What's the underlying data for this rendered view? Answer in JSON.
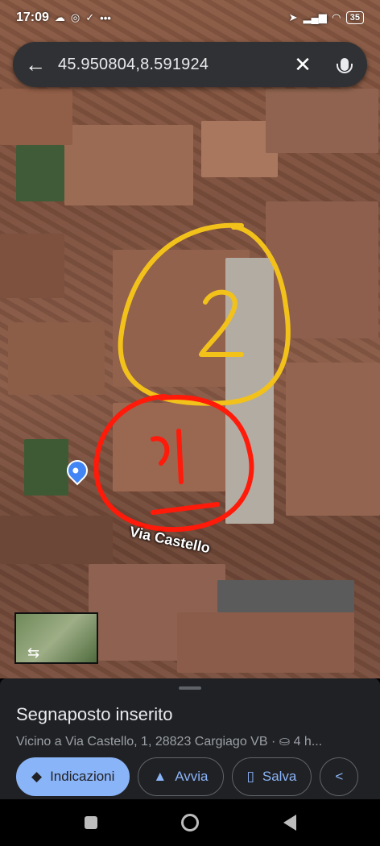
{
  "status": {
    "time": "17:09",
    "battery": "35"
  },
  "search": {
    "query": "45.950804,8.591924"
  },
  "map": {
    "street_label": "Via Castello",
    "annotation_numbers": [
      "2",
      "1"
    ]
  },
  "place": {
    "title": "Segnaposto inserito",
    "address": "Vicino a Via Castello, 1, 28823 Cargiago VB · ⛀ 4 h..."
  },
  "actions": [
    {
      "label": "Indicazioni",
      "icon": "directions-icon"
    },
    {
      "label": "Avvia",
      "icon": "navigation-arrow-icon"
    },
    {
      "label": "Salva",
      "icon": "bookmark-icon"
    }
  ],
  "colors": {
    "annotation_yellow": "#f2c21b",
    "annotation_red": "#ff1a0a",
    "accent": "#8ab4f8"
  }
}
